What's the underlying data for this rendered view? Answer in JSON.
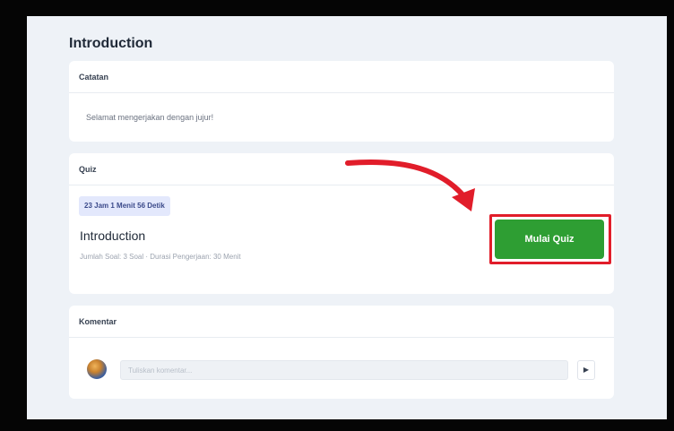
{
  "page": {
    "title": "Introduction"
  },
  "notes": {
    "header": "Catatan",
    "message": "Selamat mengerjakan dengan jujur!"
  },
  "quiz": {
    "header": "Quiz",
    "timer": "23 Jam 1 Menit 56 Detik",
    "name": "Introduction",
    "meta": "Jumlah Soal: 3 Soal · Durasi Pengerjaan: 30 Menit",
    "start_label": "Mulai Quiz"
  },
  "comments": {
    "header": "Komentar",
    "placeholder": "Tuliskan komentar...",
    "send_icon": "▶"
  },
  "colors": {
    "accent_green": "#2e9e33",
    "annotation_red": "#e11d2a",
    "timer_badge_bg": "#e3e8fc"
  },
  "icons": {
    "send": "play-triangle-icon",
    "annotation": "curved-arrow-icon"
  }
}
